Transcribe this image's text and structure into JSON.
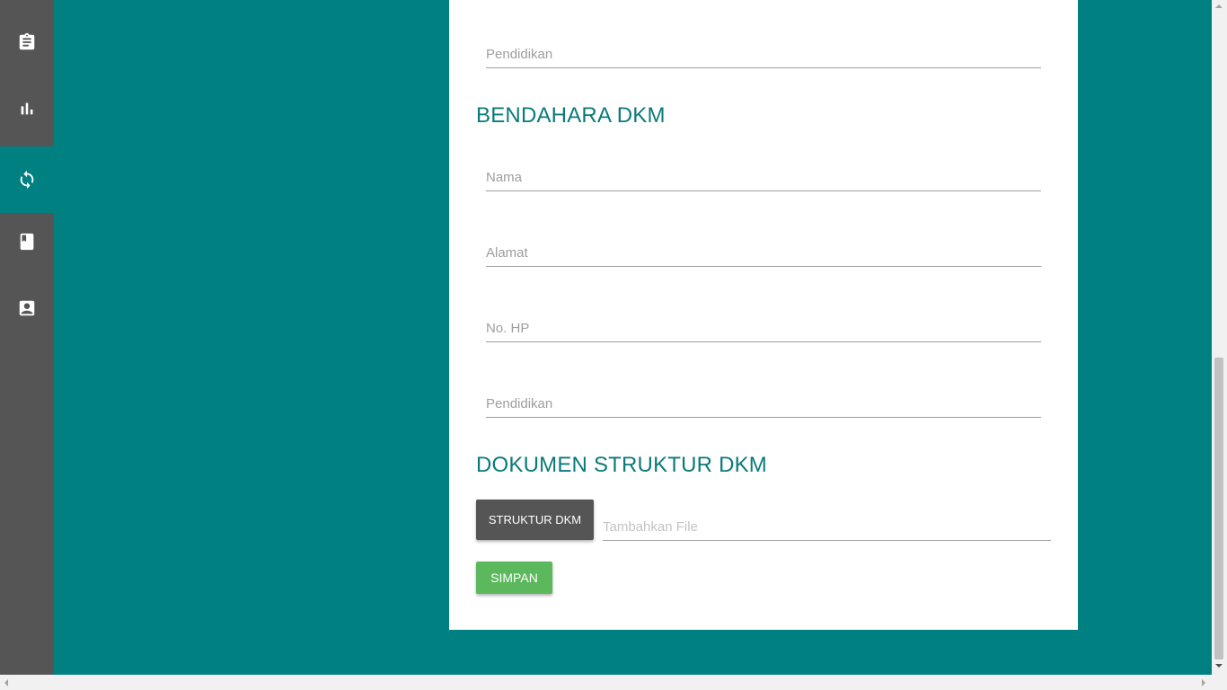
{
  "sidebar": {
    "items": [
      {
        "icon": "clipboard-icon",
        "active": false
      },
      {
        "icon": "bar-chart-icon",
        "active": false
      },
      {
        "icon": "sync-icon",
        "active": true
      },
      {
        "icon": "book-icon",
        "active": false
      },
      {
        "icon": "contact-card-icon",
        "active": false
      }
    ]
  },
  "form": {
    "ketua_pendidikan_placeholder": "Pendidikan",
    "bendahara": {
      "title": "BENDAHARA DKM",
      "nama_placeholder": "Nama",
      "alamat_placeholder": "Alamat",
      "hp_placeholder": "No. HP",
      "pendidikan_placeholder": "Pendidikan"
    },
    "dokumen": {
      "title": "DOKUMEN STRUKTUR DKM",
      "file_button_label": "STRUKTUR DKM",
      "file_placeholder": "Tambahkan File"
    },
    "save_label": "SIMPAN"
  },
  "colors": {
    "background": "#008080",
    "sidebar": "#555555",
    "title": "#0b7a7a",
    "save_button": "#5cb85c"
  }
}
